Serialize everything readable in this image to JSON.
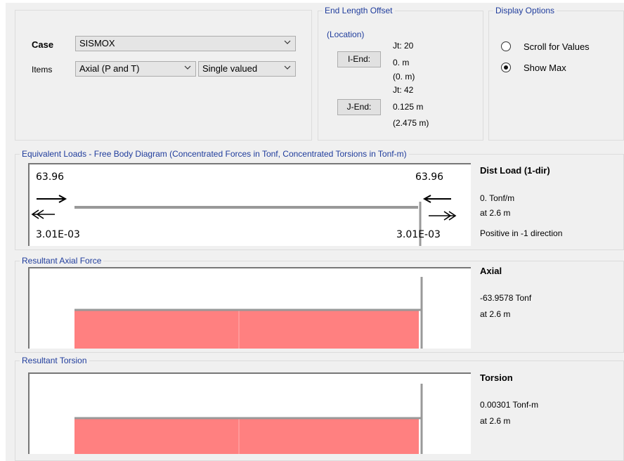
{
  "case": {
    "label": "Case",
    "value": "SISMOX"
  },
  "items": {
    "label": "Items",
    "value": "Axial (P and T)",
    "mode": "Single valued"
  },
  "end_offset": {
    "title": "End Length Offset",
    "location_label": "(Location)",
    "i_end": {
      "button": "I-End:",
      "jt": "Jt:  20",
      "value": "0. m",
      "paren": "(0. m)"
    },
    "j_end": {
      "button": "J-End:",
      "jt": "Jt:  42",
      "value": "0.125 m",
      "paren": "(2.475 m)"
    }
  },
  "display_options": {
    "title": "Display Options",
    "options": [
      {
        "label": "Scroll for Values",
        "selected": false
      },
      {
        "label": "Show Max",
        "selected": true
      }
    ]
  },
  "fbd": {
    "title": "Equivalent Loads - Free Body Diagram  (Concentrated Forces in Tonf, Concentrated Torsions in Tonf-m)",
    "left_force": "63.96",
    "right_force": "63.96",
    "left_torsion": "3.01E-03",
    "right_torsion": "3.01E-03",
    "info_title": "Dist Load (1-dir)",
    "info_value": "0. Tonf/m",
    "info_at": "at 2.6 m",
    "info_dir": "Positive in -1 direction"
  },
  "axial": {
    "title": "Resultant Axial Force",
    "info_title": "Axial",
    "info_value": "-63.9578 Tonf",
    "info_at": "at 2.6 m"
  },
  "torsion": {
    "title": "Resultant Torsion",
    "info_title": "Torsion",
    "info_value": "0.00301 Tonf-m",
    "info_at": "at 2.6 m"
  },
  "colors": {
    "fill": "#ff8080",
    "legend": "#1f3c9c"
  }
}
